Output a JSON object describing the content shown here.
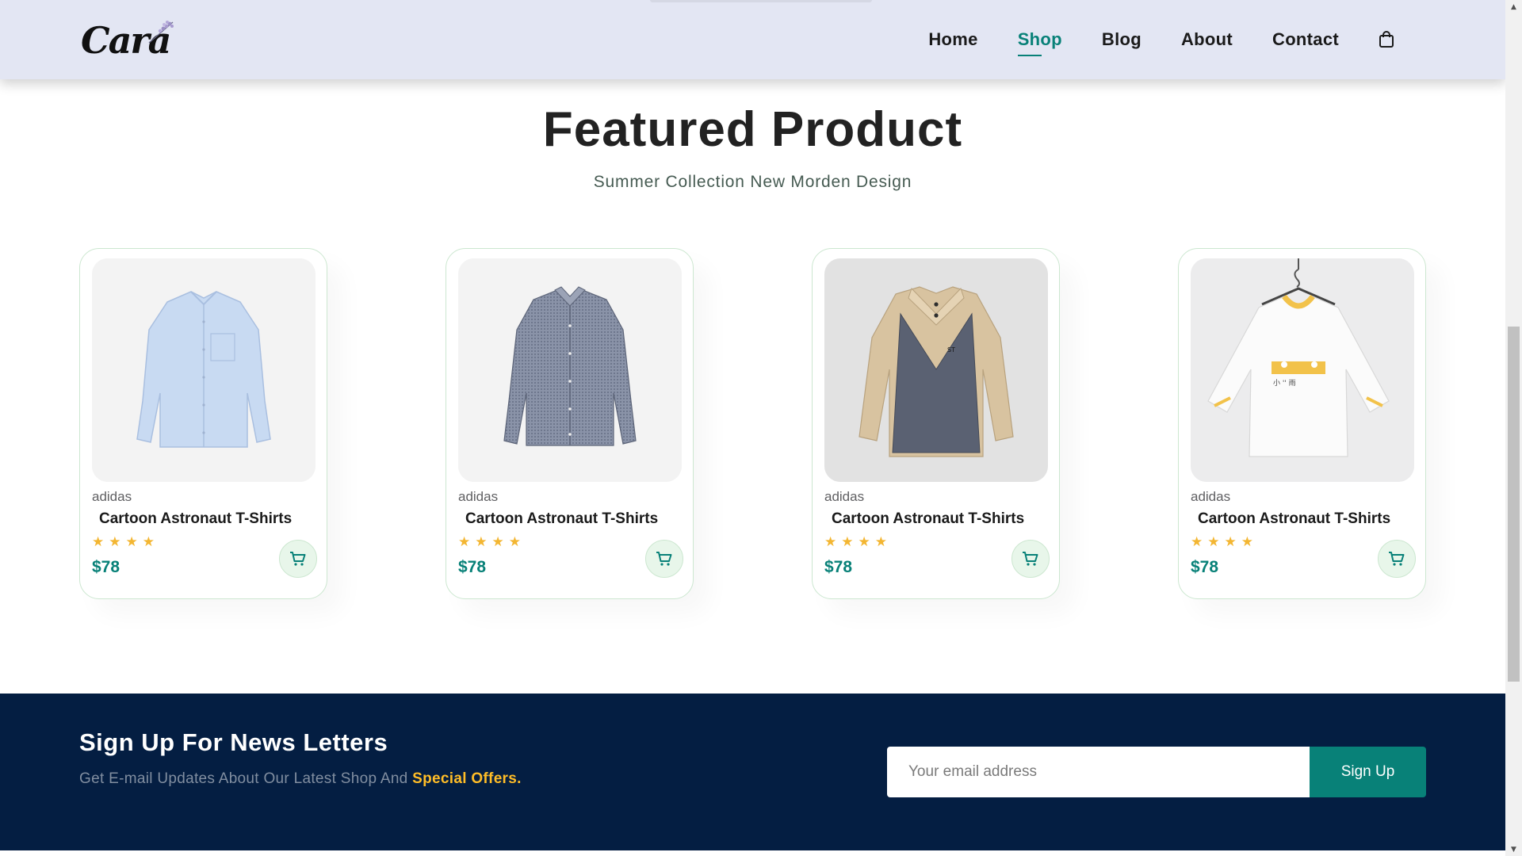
{
  "header": {
    "logo_text": "Cara",
    "nav": [
      {
        "label": "Home",
        "active": false
      },
      {
        "label": "Shop",
        "active": true
      },
      {
        "label": "Blog",
        "active": false
      },
      {
        "label": "About",
        "active": false
      },
      {
        "label": "Contact",
        "active": false
      }
    ],
    "cart_icon": "shopping-bag-icon"
  },
  "featured": {
    "title": "Featured Product",
    "subtitle": "Summer Collection New Morden Design",
    "products": [
      {
        "brand": "adidas",
        "name": "Cartoon Astronaut T-Shirts",
        "rating": 4,
        "price": "$78",
        "image": "light-blue-shirt"
      },
      {
        "brand": "adidas",
        "name": "Cartoon Astronaut T-Shirts",
        "rating": 4,
        "price": "$78",
        "image": "grey-checked-shirt"
      },
      {
        "brand": "adidas",
        "name": "Cartoon Astronaut T-Shirts",
        "rating": 4,
        "price": "$78",
        "image": "vest-sweater"
      },
      {
        "brand": "adidas",
        "name": "Cartoon Astronaut T-Shirts",
        "rating": 4,
        "price": "$78",
        "image": "white-tee-on-hanger"
      }
    ]
  },
  "newsletter": {
    "title": "Sign Up For News Letters",
    "text": "Get E-mail Updates About Our Latest Shop And",
    "highlight": "Special Offers.",
    "input_placeholder": "Your email address",
    "button_label": "Sign Up"
  },
  "colors": {
    "header_bg": "#e3e6f3",
    "accent": "#088178",
    "newsletter_bg": "#041e42",
    "star": "#f3b632",
    "highlight": "#ffbd27"
  }
}
